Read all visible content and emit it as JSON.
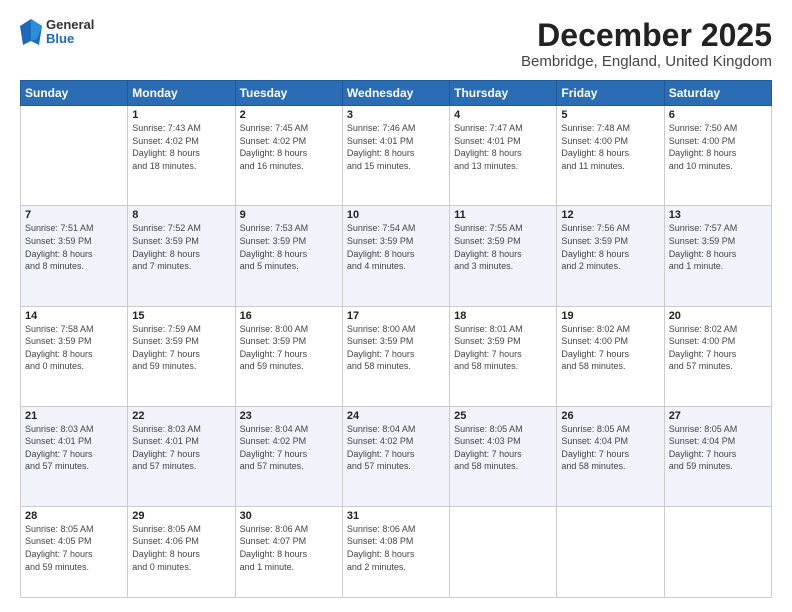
{
  "header": {
    "logo_general": "General",
    "logo_blue": "Blue",
    "month_title": "December 2025",
    "location": "Bembridge, England, United Kingdom"
  },
  "weekdays": [
    "Sunday",
    "Monday",
    "Tuesday",
    "Wednesday",
    "Thursday",
    "Friday",
    "Saturday"
  ],
  "weeks": [
    [
      {
        "day": "",
        "info": ""
      },
      {
        "day": "1",
        "info": "Sunrise: 7:43 AM\nSunset: 4:02 PM\nDaylight: 8 hours\nand 18 minutes."
      },
      {
        "day": "2",
        "info": "Sunrise: 7:45 AM\nSunset: 4:02 PM\nDaylight: 8 hours\nand 16 minutes."
      },
      {
        "day": "3",
        "info": "Sunrise: 7:46 AM\nSunset: 4:01 PM\nDaylight: 8 hours\nand 15 minutes."
      },
      {
        "day": "4",
        "info": "Sunrise: 7:47 AM\nSunset: 4:01 PM\nDaylight: 8 hours\nand 13 minutes."
      },
      {
        "day": "5",
        "info": "Sunrise: 7:48 AM\nSunset: 4:00 PM\nDaylight: 8 hours\nand 11 minutes."
      },
      {
        "day": "6",
        "info": "Sunrise: 7:50 AM\nSunset: 4:00 PM\nDaylight: 8 hours\nand 10 minutes."
      }
    ],
    [
      {
        "day": "7",
        "info": "Sunrise: 7:51 AM\nSunset: 3:59 PM\nDaylight: 8 hours\nand 8 minutes."
      },
      {
        "day": "8",
        "info": "Sunrise: 7:52 AM\nSunset: 3:59 PM\nDaylight: 8 hours\nand 7 minutes."
      },
      {
        "day": "9",
        "info": "Sunrise: 7:53 AM\nSunset: 3:59 PM\nDaylight: 8 hours\nand 5 minutes."
      },
      {
        "day": "10",
        "info": "Sunrise: 7:54 AM\nSunset: 3:59 PM\nDaylight: 8 hours\nand 4 minutes."
      },
      {
        "day": "11",
        "info": "Sunrise: 7:55 AM\nSunset: 3:59 PM\nDaylight: 8 hours\nand 3 minutes."
      },
      {
        "day": "12",
        "info": "Sunrise: 7:56 AM\nSunset: 3:59 PM\nDaylight: 8 hours\nand 2 minutes."
      },
      {
        "day": "13",
        "info": "Sunrise: 7:57 AM\nSunset: 3:59 PM\nDaylight: 8 hours\nand 1 minute."
      }
    ],
    [
      {
        "day": "14",
        "info": "Sunrise: 7:58 AM\nSunset: 3:59 PM\nDaylight: 8 hours\nand 0 minutes."
      },
      {
        "day": "15",
        "info": "Sunrise: 7:59 AM\nSunset: 3:59 PM\nDaylight: 7 hours\nand 59 minutes."
      },
      {
        "day": "16",
        "info": "Sunrise: 8:00 AM\nSunset: 3:59 PM\nDaylight: 7 hours\nand 59 minutes."
      },
      {
        "day": "17",
        "info": "Sunrise: 8:00 AM\nSunset: 3:59 PM\nDaylight: 7 hours\nand 58 minutes."
      },
      {
        "day": "18",
        "info": "Sunrise: 8:01 AM\nSunset: 3:59 PM\nDaylight: 7 hours\nand 58 minutes."
      },
      {
        "day": "19",
        "info": "Sunrise: 8:02 AM\nSunset: 4:00 PM\nDaylight: 7 hours\nand 58 minutes."
      },
      {
        "day": "20",
        "info": "Sunrise: 8:02 AM\nSunset: 4:00 PM\nDaylight: 7 hours\nand 57 minutes."
      }
    ],
    [
      {
        "day": "21",
        "info": "Sunrise: 8:03 AM\nSunset: 4:01 PM\nDaylight: 7 hours\nand 57 minutes."
      },
      {
        "day": "22",
        "info": "Sunrise: 8:03 AM\nSunset: 4:01 PM\nDaylight: 7 hours\nand 57 minutes."
      },
      {
        "day": "23",
        "info": "Sunrise: 8:04 AM\nSunset: 4:02 PM\nDaylight: 7 hours\nand 57 minutes."
      },
      {
        "day": "24",
        "info": "Sunrise: 8:04 AM\nSunset: 4:02 PM\nDaylight: 7 hours\nand 57 minutes."
      },
      {
        "day": "25",
        "info": "Sunrise: 8:05 AM\nSunset: 4:03 PM\nDaylight: 7 hours\nand 58 minutes."
      },
      {
        "day": "26",
        "info": "Sunrise: 8:05 AM\nSunset: 4:04 PM\nDaylight: 7 hours\nand 58 minutes."
      },
      {
        "day": "27",
        "info": "Sunrise: 8:05 AM\nSunset: 4:04 PM\nDaylight: 7 hours\nand 59 minutes."
      }
    ],
    [
      {
        "day": "28",
        "info": "Sunrise: 8:05 AM\nSunset: 4:05 PM\nDaylight: 7 hours\nand 59 minutes."
      },
      {
        "day": "29",
        "info": "Sunrise: 8:05 AM\nSunset: 4:06 PM\nDaylight: 8 hours\nand 0 minutes."
      },
      {
        "day": "30",
        "info": "Sunrise: 8:06 AM\nSunset: 4:07 PM\nDaylight: 8 hours\nand 1 minute."
      },
      {
        "day": "31",
        "info": "Sunrise: 8:06 AM\nSunset: 4:08 PM\nDaylight: 8 hours\nand 2 minutes."
      },
      {
        "day": "",
        "info": ""
      },
      {
        "day": "",
        "info": ""
      },
      {
        "day": "",
        "info": ""
      }
    ]
  ]
}
